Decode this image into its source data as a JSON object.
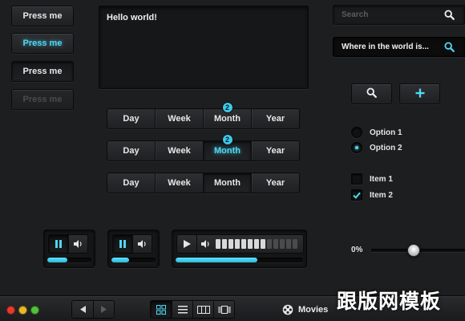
{
  "buttons": {
    "press_default": "Press me",
    "press_active": "Press me",
    "press_pressed": "Press me",
    "press_disabled": "Press me"
  },
  "textarea": {
    "value": "Hello world!"
  },
  "search": {
    "placeholder": "Search",
    "value": "Where in the world is..."
  },
  "segments": {
    "labels": [
      "Day",
      "Week",
      "Month",
      "Year"
    ],
    "badge_count": "2"
  },
  "options": {
    "radio": [
      "Option 1",
      "Option 2"
    ],
    "checkbox": [
      "Item 1",
      "Item 2"
    ]
  },
  "slider": {
    "label": "0%",
    "value": 0.45
  },
  "players": {
    "small_progress": 0.45,
    "small2_progress": 0.4,
    "large_progress": 0.64,
    "volume_level": 0.62
  },
  "bottombar": {
    "section_label": "Movies"
  },
  "watermark": "跟版网模板",
  "colors": {
    "accent": "#4fd8f4",
    "traffic_red": "#e63a2f",
    "traffic_yellow": "#e9b72a",
    "traffic_green": "#53c13a"
  },
  "icons": [
    "search-icon",
    "plus-icon",
    "pause-icon",
    "speaker-icon",
    "play-icon",
    "prev-icon",
    "next-icon",
    "grid-icon",
    "list-icon",
    "columns-icon",
    "coverflow-icon",
    "film-reel-icon",
    "checkmark-icon"
  ]
}
